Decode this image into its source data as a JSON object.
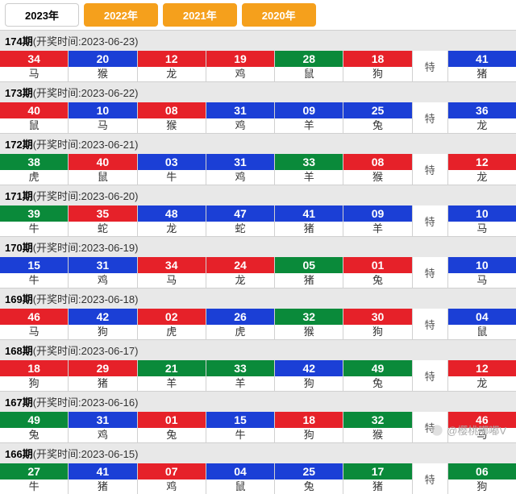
{
  "tabs": [
    {
      "label": "2023年",
      "active": true
    },
    {
      "label": "2022年",
      "active": false
    },
    {
      "label": "2021年",
      "active": false
    },
    {
      "label": "2020年",
      "active": false
    }
  ],
  "special_label": "特",
  "issues": [
    {
      "issue": "174",
      "date": "2023-06-23",
      "balls": [
        {
          "n": "34",
          "c": "red",
          "z": "马"
        },
        {
          "n": "20",
          "c": "blue",
          "z": "猴"
        },
        {
          "n": "12",
          "c": "red",
          "z": "龙"
        },
        {
          "n": "19",
          "c": "red",
          "z": "鸡"
        },
        {
          "n": "28",
          "c": "green",
          "z": "鼠"
        },
        {
          "n": "18",
          "c": "red",
          "z": "狗"
        }
      ],
      "special": {
        "n": "41",
        "c": "blue",
        "z": "猪"
      }
    },
    {
      "issue": "173",
      "date": "2023-06-22",
      "balls": [
        {
          "n": "40",
          "c": "red",
          "z": "鼠"
        },
        {
          "n": "10",
          "c": "blue",
          "z": "马"
        },
        {
          "n": "08",
          "c": "red",
          "z": "猴"
        },
        {
          "n": "31",
          "c": "blue",
          "z": "鸡"
        },
        {
          "n": "09",
          "c": "blue",
          "z": "羊"
        },
        {
          "n": "25",
          "c": "blue",
          "z": "兔"
        }
      ],
      "special": {
        "n": "36",
        "c": "blue",
        "z": "龙"
      }
    },
    {
      "issue": "172",
      "date": "2023-06-21",
      "balls": [
        {
          "n": "38",
          "c": "green",
          "z": "虎"
        },
        {
          "n": "40",
          "c": "red",
          "z": "鼠"
        },
        {
          "n": "03",
          "c": "blue",
          "z": "牛"
        },
        {
          "n": "31",
          "c": "blue",
          "z": "鸡"
        },
        {
          "n": "33",
          "c": "green",
          "z": "羊"
        },
        {
          "n": "08",
          "c": "red",
          "z": "猴"
        }
      ],
      "special": {
        "n": "12",
        "c": "red",
        "z": "龙"
      }
    },
    {
      "issue": "171",
      "date": "2023-06-20",
      "balls": [
        {
          "n": "39",
          "c": "green",
          "z": "牛"
        },
        {
          "n": "35",
          "c": "red",
          "z": "蛇"
        },
        {
          "n": "48",
          "c": "blue",
          "z": "龙"
        },
        {
          "n": "47",
          "c": "blue",
          "z": "蛇"
        },
        {
          "n": "41",
          "c": "blue",
          "z": "猪"
        },
        {
          "n": "09",
          "c": "blue",
          "z": "羊"
        }
      ],
      "special": {
        "n": "10",
        "c": "blue",
        "z": "马"
      }
    },
    {
      "issue": "170",
      "date": "2023-06-19",
      "balls": [
        {
          "n": "15",
          "c": "blue",
          "z": "牛"
        },
        {
          "n": "31",
          "c": "blue",
          "z": "鸡"
        },
        {
          "n": "34",
          "c": "red",
          "z": "马"
        },
        {
          "n": "24",
          "c": "red",
          "z": "龙"
        },
        {
          "n": "05",
          "c": "green",
          "z": "猪"
        },
        {
          "n": "01",
          "c": "red",
          "z": "兔"
        }
      ],
      "special": {
        "n": "10",
        "c": "blue",
        "z": "马"
      }
    },
    {
      "issue": "169",
      "date": "2023-06-18",
      "balls": [
        {
          "n": "46",
          "c": "red",
          "z": "马"
        },
        {
          "n": "42",
          "c": "blue",
          "z": "狗"
        },
        {
          "n": "02",
          "c": "red",
          "z": "虎"
        },
        {
          "n": "26",
          "c": "blue",
          "z": "虎"
        },
        {
          "n": "32",
          "c": "green",
          "z": "猴"
        },
        {
          "n": "30",
          "c": "red",
          "z": "狗"
        }
      ],
      "special": {
        "n": "04",
        "c": "blue",
        "z": "鼠"
      }
    },
    {
      "issue": "168",
      "date": "2023-06-17",
      "balls": [
        {
          "n": "18",
          "c": "red",
          "z": "狗"
        },
        {
          "n": "29",
          "c": "red",
          "z": "猪"
        },
        {
          "n": "21",
          "c": "green",
          "z": "羊"
        },
        {
          "n": "33",
          "c": "green",
          "z": "羊"
        },
        {
          "n": "42",
          "c": "blue",
          "z": "狗"
        },
        {
          "n": "49",
          "c": "green",
          "z": "兔"
        }
      ],
      "special": {
        "n": "12",
        "c": "red",
        "z": "龙"
      }
    },
    {
      "issue": "167",
      "date": "2023-06-16",
      "balls": [
        {
          "n": "49",
          "c": "green",
          "z": "兔"
        },
        {
          "n": "31",
          "c": "blue",
          "z": "鸡"
        },
        {
          "n": "01",
          "c": "red",
          "z": "兔"
        },
        {
          "n": "15",
          "c": "blue",
          "z": "牛"
        },
        {
          "n": "18",
          "c": "red",
          "z": "狗"
        },
        {
          "n": "32",
          "c": "green",
          "z": "猴"
        }
      ],
      "special": {
        "n": "46",
        "c": "red",
        "z": "马"
      }
    },
    {
      "issue": "166",
      "date": "2023-06-15",
      "balls": [
        {
          "n": "27",
          "c": "green",
          "z": "牛"
        },
        {
          "n": "41",
          "c": "blue",
          "z": "猪"
        },
        {
          "n": "07",
          "c": "red",
          "z": "鸡"
        },
        {
          "n": "04",
          "c": "blue",
          "z": "鼠"
        },
        {
          "n": "25",
          "c": "blue",
          "z": "兔"
        },
        {
          "n": "17",
          "c": "green",
          "z": "猪"
        }
      ],
      "special": {
        "n": "06",
        "c": "green",
        "z": "狗"
      }
    }
  ],
  "watermark": "@樱桃嘟嘟V"
}
